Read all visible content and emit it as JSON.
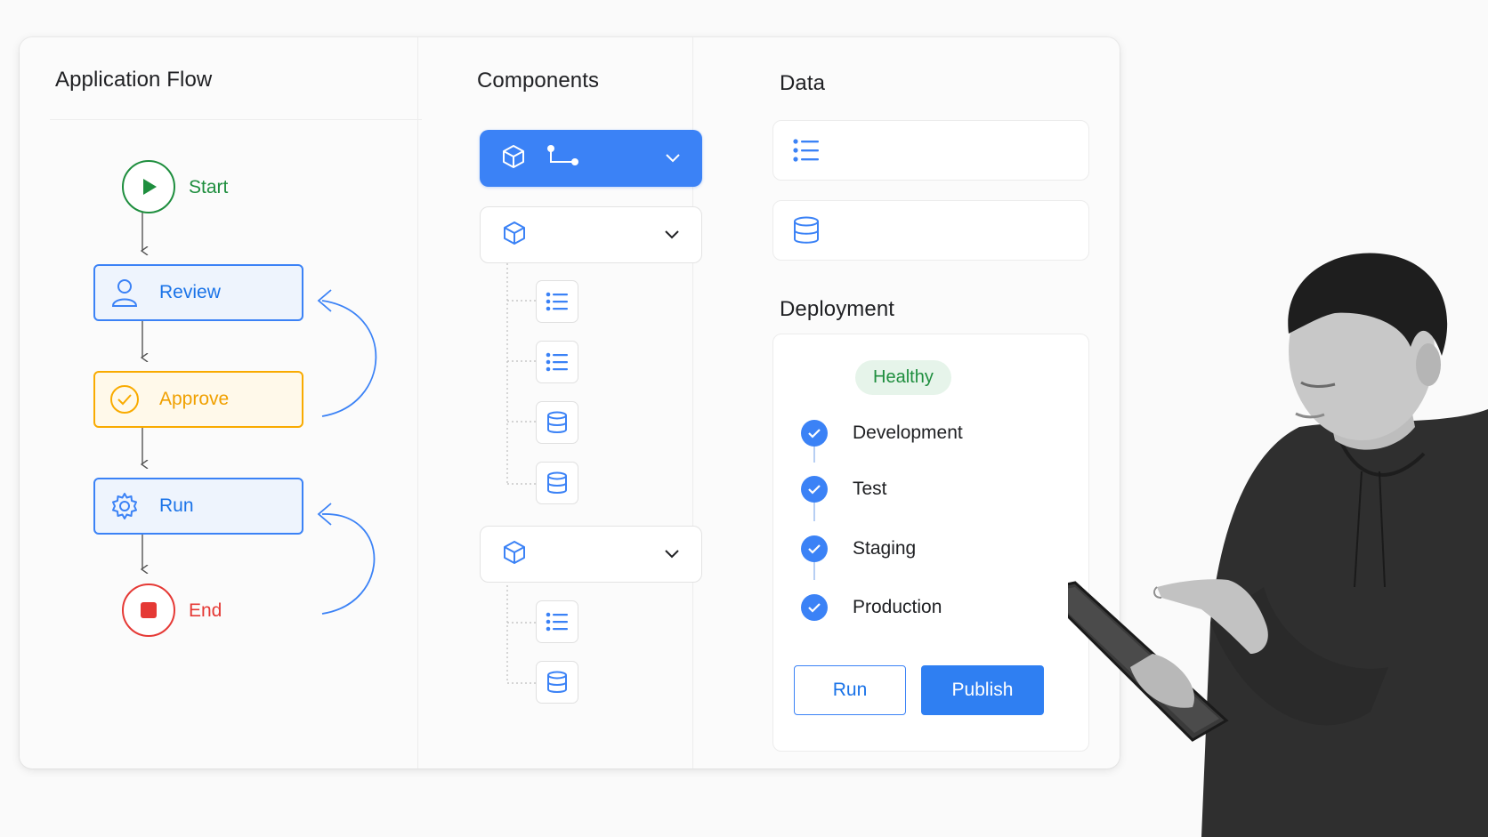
{
  "flow": {
    "title": "Application Flow",
    "start_label": "Start",
    "steps": [
      {
        "label": "Review",
        "icon": "person-icon"
      },
      {
        "label": "Approve",
        "icon": "check-circle-icon"
      },
      {
        "label": "Run",
        "icon": "gear-icon"
      }
    ],
    "end_label": "End"
  },
  "components": {
    "title": "Components",
    "groups": [
      {
        "icon": "cube-icon",
        "extra_icon": "branch-icon",
        "active": true,
        "children": []
      },
      {
        "icon": "cube-icon",
        "active": false,
        "children": [
          "list-icon",
          "list-icon",
          "database-icon",
          "database-icon"
        ]
      },
      {
        "icon": "cube-icon",
        "active": false,
        "children": [
          "list-icon",
          "database-icon"
        ]
      }
    ]
  },
  "data": {
    "title": "Data",
    "items": [
      "list-icon",
      "database-icon"
    ]
  },
  "deployment": {
    "title": "Deployment",
    "status": "Healthy",
    "stages": [
      "Development",
      "Test",
      "Staging",
      "Production"
    ],
    "run_label": "Run",
    "publish_label": "Publish"
  },
  "colors": {
    "accent": "#3b82f6",
    "start": "#1e8e3e",
    "approve": "#f9ab00",
    "end": "#e53935",
    "healthy_bg": "#e6f4ea"
  }
}
